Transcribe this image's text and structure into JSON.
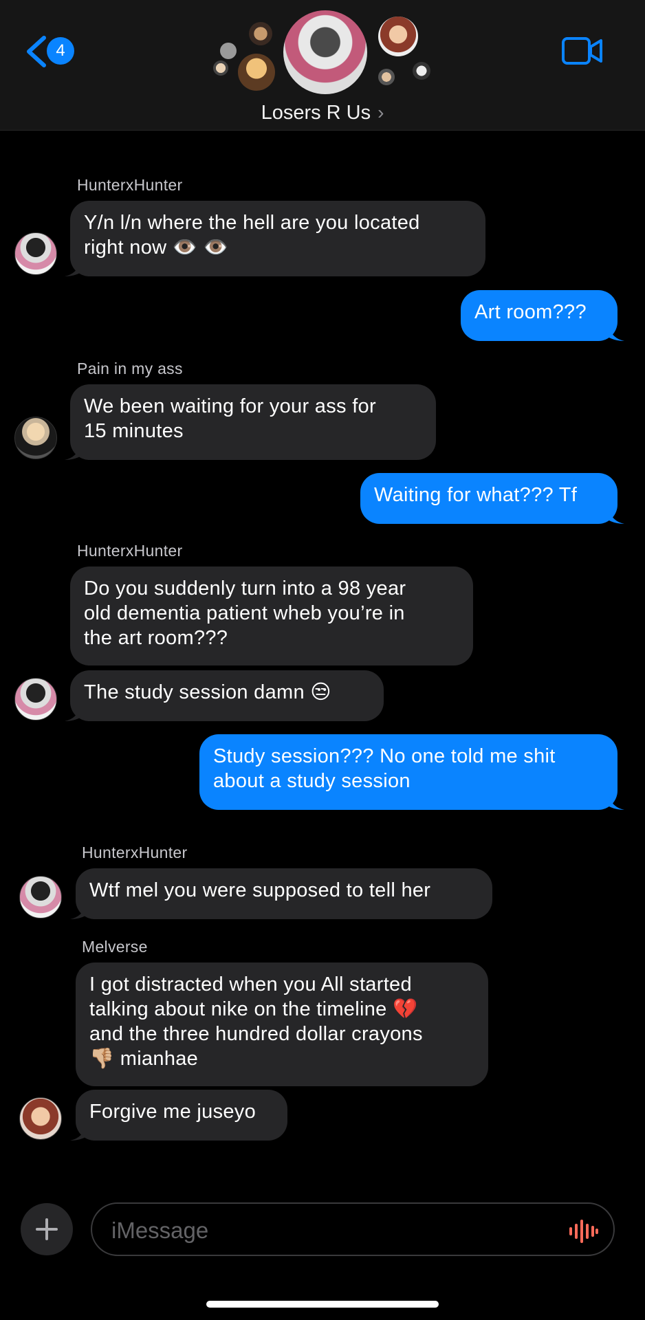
{
  "header": {
    "back_count": "4",
    "group_name": "Losers R Us",
    "chevron": "›"
  },
  "messages": [
    {
      "sender": "HunterxHunter",
      "text_line1": "Y/n l/n where the hell are you located",
      "text_line2": "right now 👁️ 👁️",
      "direction": "incoming"
    },
    {
      "text": "Art room???",
      "direction": "outgoing"
    },
    {
      "sender": "Pain in my ass",
      "text_line1": "We been waiting for your ass for",
      "text_line2": "15 minutes",
      "direction": "incoming"
    },
    {
      "text": "Waiting for what??? Tf",
      "direction": "outgoing"
    },
    {
      "sender": "HunterxHunter",
      "text_line1": "Do you suddenly turn into a 98 year",
      "text_line2": "old dementia patient wheb you’re in",
      "text_line3": "the art room???",
      "direction": "incoming"
    },
    {
      "text": "The study session damn 😒",
      "direction": "incoming"
    },
    {
      "text_line1": "Study session??? No one told me shit",
      "text_line2": "about a study session",
      "direction": "outgoing"
    },
    {
      "sender": "HunterxHunter",
      "text": "Wtf mel you were supposed to tell her",
      "direction": "incoming"
    },
    {
      "sender": "Melverse",
      "text_line1": "I got distracted when you All started",
      "text_line2": "talking about nike on the timeline 💔",
      "text_line3": "and the three hundred dollar crayons",
      "text_line4": "👎🏼 mianhae",
      "direction": "incoming"
    },
    {
      "text": "Forgive me juseyo",
      "direction": "incoming"
    }
  ],
  "composer": {
    "placeholder": "iMessage"
  },
  "icons": {
    "back": "chevron-left-icon",
    "video": "video-camera-icon",
    "plus": "plus-icon",
    "audio": "audio-waveform-icon"
  },
  "colors": {
    "accent": "#0a84ff",
    "incoming_bubble": "#262628",
    "audio_icon": "#ff6b5a"
  }
}
